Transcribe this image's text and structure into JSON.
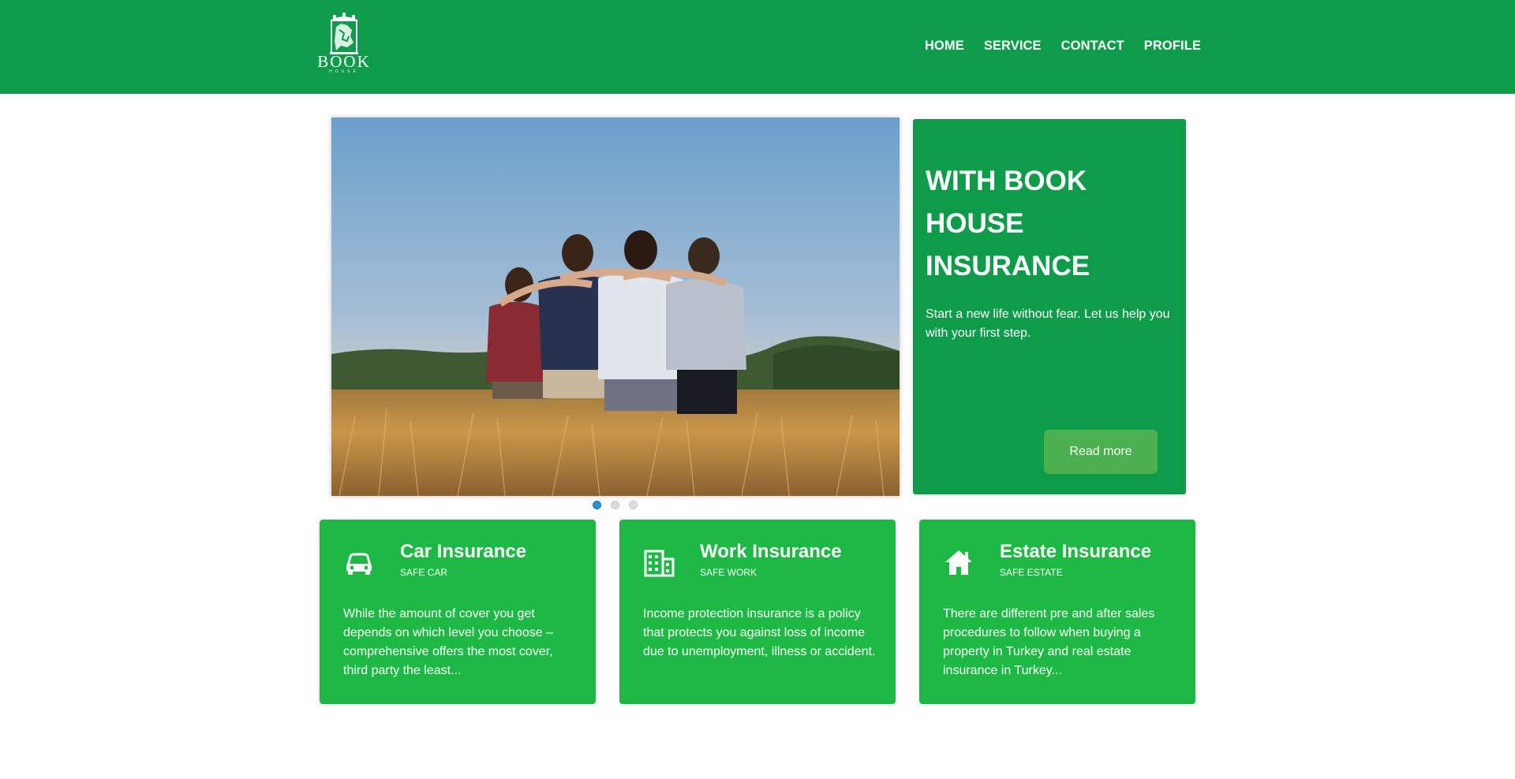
{
  "header": {
    "logo_text": "BOOK",
    "logo_sub": "HOUSE",
    "nav": [
      "HOME",
      "SERVICE",
      "CONTACT",
      "PROFILE"
    ]
  },
  "slider": {
    "image": "friends-in-wheat-field",
    "slide_count": 3,
    "active_slide": 1
  },
  "promo": {
    "title": "WITH BOOK HOUSE INSURANCE",
    "text": "Start a new life without fear. Let us help you with your first step.",
    "button": "Read more"
  },
  "cards": [
    {
      "icon": "car-icon",
      "title": "Car Insurance",
      "subtitle": "SAFE CAR",
      "text": "While the amount of cover you get depends on which level you choose – comprehensive offers the most cover, third party the least..."
    },
    {
      "icon": "building-icon",
      "title": "Work Insurance",
      "subtitle": "SAFE WORK",
      "text": "Income protection insurance is a policy that protects you against loss of income due to unemployment, illness or accident."
    },
    {
      "icon": "house-icon",
      "title": "Estate Insurance",
      "subtitle": "SAFE ESTATE",
      "text": "There are different pre and after sales procedures to follow when buying a property in Turkey and real estate insurance in Turkey..."
    }
  ],
  "colors": {
    "header": "#0e9c4b",
    "promo": "#0e9c4b",
    "card": "#1db944",
    "button": "#4caf50",
    "active_dot": "#2a8fd8"
  }
}
